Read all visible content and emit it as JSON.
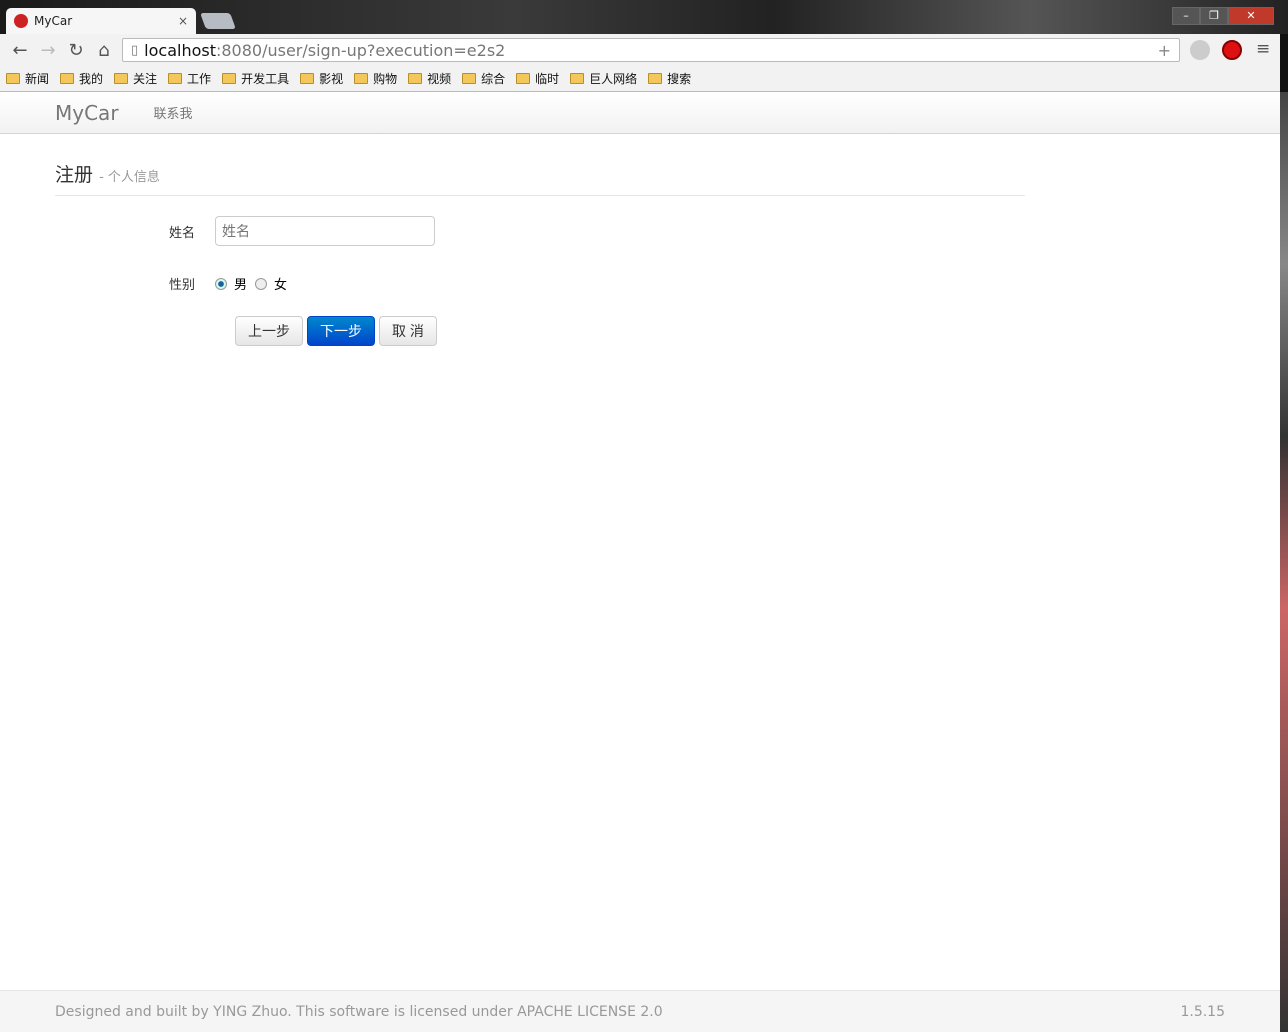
{
  "browser": {
    "tab_title": "MyCar",
    "url_host": "localhost",
    "url_rest": ":8080/user/sign-up?execution=e2s2",
    "bookmarks": [
      "新闻",
      "我的",
      "关注",
      "工作",
      "开发工具",
      "影视",
      "购物",
      "视频",
      "综合",
      "临时",
      "巨人网络",
      "搜索"
    ]
  },
  "navbar": {
    "brand": "MyCar",
    "link": "联系我"
  },
  "header": {
    "title": "注册",
    "subtitle": "- 个人信息"
  },
  "form": {
    "name_label": "姓名",
    "name_placeholder": "姓名",
    "gender_label": "性别",
    "male": "男",
    "female": "女",
    "selected": "男",
    "prev": "上一步",
    "next": "下一步",
    "cancel": "取 消"
  },
  "footer": {
    "text": "Designed and built by YING Zhuo. This software is licensed under APACHE LICENSE 2.0",
    "version": "1.5.15"
  }
}
